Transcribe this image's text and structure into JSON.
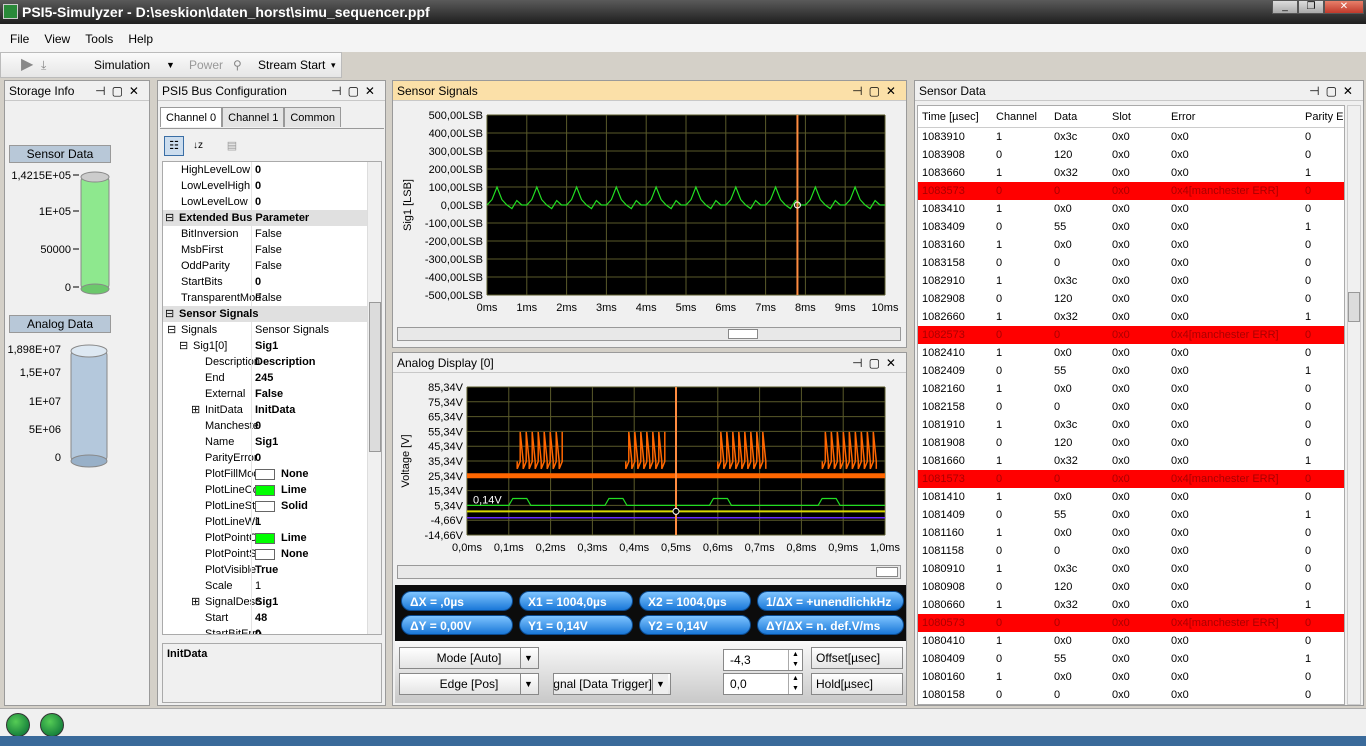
{
  "window": {
    "title": "PSI5-Simulyzer - D:\\seskion\\daten_horst\\simu_sequencer.ppf",
    "buttons": [
      "_",
      "❐",
      "✕"
    ]
  },
  "menu": [
    "File",
    "View",
    "Tools",
    "Help"
  ],
  "toolbar": {
    "mode": "Simulation",
    "power": "Power",
    "stream": "Stream Start"
  },
  "storage_panel": {
    "title": "Storage Info",
    "sensor_label": "Sensor Data",
    "sensor_ticks": [
      "1,4215E+05",
      "1E+05",
      "50000",
      "0"
    ],
    "analog_label": "Analog Data",
    "analog_ticks": [
      "1,898E+07",
      "1,5E+07",
      "1E+07",
      "5E+06",
      "0"
    ]
  },
  "bus_panel": {
    "title": "PSI5 Bus Configuration",
    "tabs": [
      "Channel 0",
      "Channel 1",
      "Common"
    ],
    "footer": "InitData",
    "rows": [
      {
        "n": "HighLevelLow",
        "v": "0",
        "b": true,
        "i": 0
      },
      {
        "n": "LowLevelHigh",
        "v": "0",
        "b": true,
        "i": 0
      },
      {
        "n": "LowLevelLow",
        "v": "0",
        "b": true,
        "i": 0
      },
      {
        "n": "Extended Bus Parameter",
        "cat": true
      },
      {
        "n": "BitInversion",
        "v": "False",
        "i": 0
      },
      {
        "n": "MsbFirst",
        "v": "False",
        "i": 0
      },
      {
        "n": "OddParity",
        "v": "False",
        "i": 0
      },
      {
        "n": "StartBits",
        "v": "0",
        "b": true,
        "i": 0
      },
      {
        "n": "TransparentMod",
        "v": "False",
        "i": 0
      },
      {
        "n": "Sensor Signals",
        "cat": true
      },
      {
        "n": "Signals",
        "v": "Sensor Signals",
        "i": 0,
        "exp": "⊟"
      },
      {
        "n": "Sig1[0]",
        "v": "Sig1",
        "b": true,
        "i": 1,
        "exp": "⊟"
      },
      {
        "n": "Description",
        "v": "Description",
        "b": true,
        "i": 2
      },
      {
        "n": "End",
        "v": "245",
        "b": true,
        "i": 2
      },
      {
        "n": "External",
        "v": "False",
        "b": true,
        "i": 2
      },
      {
        "n": "InitData",
        "v": "InitData",
        "b": true,
        "i": 2,
        "exp": "⊞"
      },
      {
        "n": "Mancheste",
        "v": "0",
        "b": true,
        "i": 2
      },
      {
        "n": "Name",
        "v": "Sig1",
        "b": true,
        "i": 2
      },
      {
        "n": "ParityError",
        "v": "0",
        "b": true,
        "i": 2
      },
      {
        "n": "PlotFillMode",
        "v": "None",
        "b": true,
        "i": 2,
        "sw": "#ffffff",
        "swline": true
      },
      {
        "n": "PlotLineCol",
        "v": "Lime",
        "b": true,
        "i": 2,
        "sw": "#00ff00"
      },
      {
        "n": "PlotLineSty",
        "v": "Solid",
        "b": true,
        "i": 2,
        "sw": "#ffffff"
      },
      {
        "n": "PlotLineWi",
        "v": "1",
        "b": true,
        "i": 2
      },
      {
        "n": "PlotPointCo",
        "v": "Lime",
        "b": true,
        "i": 2,
        "sw": "#00ff00"
      },
      {
        "n": "PlotPointSt",
        "v": "None",
        "b": true,
        "i": 2,
        "sw": "#ffffff"
      },
      {
        "n": "PlotVisible",
        "v": "True",
        "b": true,
        "i": 2
      },
      {
        "n": "Scale",
        "v": "1",
        "i": 2
      },
      {
        "n": "SignalDesc",
        "v": "Sig1",
        "b": true,
        "i": 2,
        "exp": "⊞"
      },
      {
        "n": "Start",
        "v": "48",
        "b": true,
        "i": 2
      },
      {
        "n": "StartBitErro",
        "v": "0",
        "b": true,
        "i": 2
      }
    ]
  },
  "sensor_signals": {
    "title": "Sensor Signals",
    "ylabel": "Sig1 [LSB]",
    "yticks": [
      "500,00LSB",
      "400,00LSB",
      "300,00LSB",
      "200,00LSB",
      "100,00LSB",
      "0,00LSB",
      "-100,00LSB",
      "-200,00LSB",
      "-300,00LSB",
      "-400,00LSB",
      "-500,00LSB"
    ],
    "xticks": [
      "0ms",
      "1ms",
      "2ms",
      "3ms",
      "4ms",
      "5ms",
      "6ms",
      "7ms",
      "8ms",
      "9ms",
      "10ms"
    ]
  },
  "analog_display": {
    "title": "Analog Display [0]",
    "ylabel": "Voltage [V]",
    "yticks": [
      "85,34V",
      "75,34V",
      "65,34V",
      "55,34V",
      "45,34V",
      "35,34V",
      "25,34V",
      "15,34V",
      "5,34V",
      "-4,66V",
      "-14,66V"
    ],
    "xticks": [
      "0,0ms",
      "0,1ms",
      "0,2ms",
      "0,3ms",
      "0,4ms",
      "0,5ms",
      "0,6ms",
      "0,7ms",
      "0,8ms",
      "0,9ms",
      "1,0ms"
    ],
    "marker_label": "0,14V"
  },
  "measurements": [
    "ΔX = ,0µs",
    "X1 = 1004,0µs",
    "X2 = 1004,0µs",
    "1/ΔX = +unendlichkHz",
    "ΔY = 0,00V",
    "Y1 = 0,14V",
    "Y2 = 0,14V",
    "ΔY/ΔX = n. def.V/ms"
  ],
  "trigger": {
    "mode": "Mode [Auto]",
    "edge": "Edge [Pos]",
    "signal": "Signal [Data Trigger]",
    "offset_value": "-4,3",
    "hold_value": "0,0",
    "offset_label": "Offset[µsec]",
    "hold_label": "Hold[µsec]"
  },
  "sensor_data": {
    "title": "Sensor Data",
    "columns": [
      "Time [µsec]",
      "Channel",
      "Data",
      "Slot",
      "Error",
      "Parity E"
    ],
    "rows": [
      [
        "1083910",
        "1",
        "0x3c",
        "0x0",
        "0x0",
        "0"
      ],
      [
        "1083908",
        "0",
        "120",
        "0x0",
        "0x0",
        "0"
      ],
      [
        "1083660",
        "1",
        "0x32",
        "0x0",
        "0x0",
        "1"
      ],
      [
        "1083573",
        "0",
        "0",
        "0x0",
        "0x4[manchester ERR]",
        "0"
      ],
      [
        "1083410",
        "1",
        "0x0",
        "0x0",
        "0x0",
        "0"
      ],
      [
        "1083409",
        "0",
        "55",
        "0x0",
        "0x0",
        "1"
      ],
      [
        "1083160",
        "1",
        "0x0",
        "0x0",
        "0x0",
        "0"
      ],
      [
        "1083158",
        "0",
        "0",
        "0x0",
        "0x0",
        "0"
      ],
      [
        "1082910",
        "1",
        "0x3c",
        "0x0",
        "0x0",
        "0"
      ],
      [
        "1082908",
        "0",
        "120",
        "0x0",
        "0x0",
        "0"
      ],
      [
        "1082660",
        "1",
        "0x32",
        "0x0",
        "0x0",
        "1"
      ],
      [
        "1082573",
        "0",
        "0",
        "0x0",
        "0x4[manchester ERR]",
        "0"
      ],
      [
        "1082410",
        "1",
        "0x0",
        "0x0",
        "0x0",
        "0"
      ],
      [
        "1082409",
        "0",
        "55",
        "0x0",
        "0x0",
        "1"
      ],
      [
        "1082160",
        "1",
        "0x0",
        "0x0",
        "0x0",
        "0"
      ],
      [
        "1082158",
        "0",
        "0",
        "0x0",
        "0x0",
        "0"
      ],
      [
        "1081910",
        "1",
        "0x3c",
        "0x0",
        "0x0",
        "0"
      ],
      [
        "1081908",
        "0",
        "120",
        "0x0",
        "0x0",
        "0"
      ],
      [
        "1081660",
        "1",
        "0x32",
        "0x0",
        "0x0",
        "1"
      ],
      [
        "1081573",
        "0",
        "0",
        "0x0",
        "0x4[manchester ERR]",
        "0"
      ],
      [
        "1081410",
        "1",
        "0x0",
        "0x0",
        "0x0",
        "0"
      ],
      [
        "1081409",
        "0",
        "55",
        "0x0",
        "0x0",
        "1"
      ],
      [
        "1081160",
        "1",
        "0x0",
        "0x0",
        "0x0",
        "0"
      ],
      [
        "1081158",
        "0",
        "0",
        "0x0",
        "0x0",
        "0"
      ],
      [
        "1080910",
        "1",
        "0x3c",
        "0x0",
        "0x0",
        "0"
      ],
      [
        "1080908",
        "0",
        "120",
        "0x0",
        "0x0",
        "0"
      ],
      [
        "1080660",
        "1",
        "0x32",
        "0x0",
        "0x0",
        "1"
      ],
      [
        "1080573",
        "0",
        "0",
        "0x0",
        "0x4[manchester ERR]",
        "0"
      ],
      [
        "1080410",
        "1",
        "0x0",
        "0x0",
        "0x0",
        "0"
      ],
      [
        "1080409",
        "0",
        "55",
        "0x0",
        "0x0",
        "1"
      ],
      [
        "1080160",
        "1",
        "0x0",
        "0x0",
        "0x0",
        "0"
      ],
      [
        "1080158",
        "0",
        "0",
        "0x0",
        "0x0",
        "0"
      ]
    ]
  },
  "colors": {
    "error_row": "#ff0000",
    "active_panel": "#fbe0a8",
    "signal": "#00ff00",
    "analog": "#ff6600",
    "cursor": "#ff8c40"
  }
}
